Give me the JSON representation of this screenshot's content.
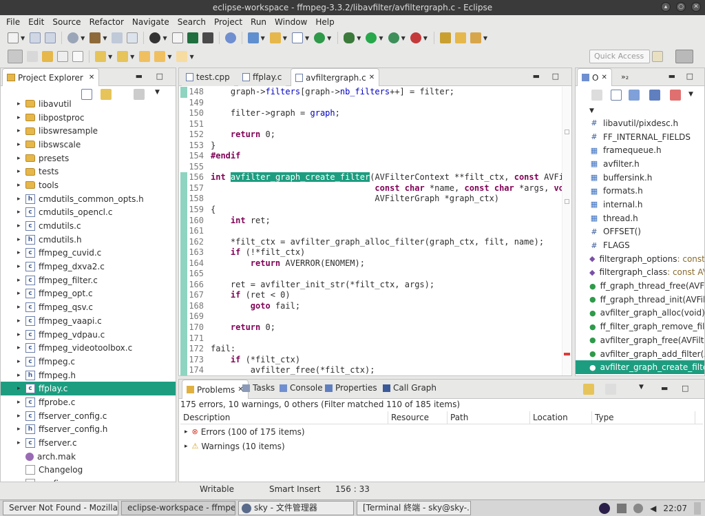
{
  "window": {
    "title": "eclipse-workspace - ffmpeg-3.3.2/libavfilter/avfiltergraph.c - Eclipse"
  },
  "menu": [
    "File",
    "Edit",
    "Source",
    "Refactor",
    "Navigate",
    "Search",
    "Project",
    "Run",
    "Window",
    "Help"
  ],
  "toolbar": {
    "quick_access_placeholder": "Quick Access"
  },
  "explorer": {
    "title": "Project Explorer",
    "items": [
      {
        "label": "libavutil",
        "kind": "folder",
        "arrow": "▸"
      },
      {
        "label": "libpostproc",
        "kind": "folder",
        "arrow": "▸"
      },
      {
        "label": "libswresample",
        "kind": "folder",
        "arrow": "▸"
      },
      {
        "label": "libswscale",
        "kind": "folder",
        "arrow": "▸"
      },
      {
        "label": "presets",
        "kind": "folder",
        "arrow": "▸"
      },
      {
        "label": "tests",
        "kind": "folder",
        "arrow": "▸"
      },
      {
        "label": "tools",
        "kind": "folder",
        "arrow": "▸"
      },
      {
        "label": "cmdutils_common_opts.h",
        "kind": "h",
        "arrow": "▸"
      },
      {
        "label": "cmdutils_opencl.c",
        "kind": "c",
        "arrow": "▸"
      },
      {
        "label": "cmdutils.c",
        "kind": "c",
        "arrow": "▸"
      },
      {
        "label": "cmdutils.h",
        "kind": "h",
        "arrow": "▸"
      },
      {
        "label": "ffmpeg_cuvid.c",
        "kind": "c",
        "arrow": "▸"
      },
      {
        "label": "ffmpeg_dxva2.c",
        "kind": "c",
        "arrow": "▸"
      },
      {
        "label": "ffmpeg_filter.c",
        "kind": "c",
        "arrow": "▸"
      },
      {
        "label": "ffmpeg_opt.c",
        "kind": "c",
        "arrow": "▸"
      },
      {
        "label": "ffmpeg_qsv.c",
        "kind": "c",
        "arrow": "▸"
      },
      {
        "label": "ffmpeg_vaapi.c",
        "kind": "c",
        "arrow": "▸"
      },
      {
        "label": "ffmpeg_vdpau.c",
        "kind": "c",
        "arrow": "▸"
      },
      {
        "label": "ffmpeg_videotoolbox.c",
        "kind": "c",
        "arrow": "▸"
      },
      {
        "label": "ffmpeg.c",
        "kind": "c",
        "arrow": "▸"
      },
      {
        "label": "ffmpeg.h",
        "kind": "h",
        "arrow": "▸"
      },
      {
        "label": "ffplay.c",
        "kind": "c",
        "arrow": "▸",
        "selected": true
      },
      {
        "label": "ffprobe.c",
        "kind": "c",
        "arrow": "▸"
      },
      {
        "label": "ffserver_config.c",
        "kind": "c",
        "arrow": "▸"
      },
      {
        "label": "ffserver_config.h",
        "kind": "h",
        "arrow": "▸"
      },
      {
        "label": "ffserver.c",
        "kind": "c",
        "arrow": "▸"
      },
      {
        "label": "arch.mak",
        "kind": "mak",
        "arrow": ""
      },
      {
        "label": "Changelog",
        "kind": "txt",
        "arrow": ""
      },
      {
        "label": "configure",
        "kind": "txt",
        "arrow": ""
      }
    ]
  },
  "editor": {
    "tabs": [
      {
        "label": "test.cpp",
        "active": false
      },
      {
        "label": "ffplay.c",
        "active": false
      },
      {
        "label": "avfiltergraph.c",
        "active": true
      }
    ],
    "lines": [
      {
        "n": "148",
        "t": "    graph->filters[graph->nb_filters++] = filter;",
        "mark": true
      },
      {
        "n": "149",
        "t": "",
        "mark": false
      },
      {
        "n": "150",
        "t": "    filter->graph = graph;",
        "mark": false
      },
      {
        "n": "151",
        "t": "",
        "mark": false
      },
      {
        "n": "152",
        "t": "    return 0;",
        "mark": false
      },
      {
        "n": "153",
        "t": "}",
        "mark": false
      },
      {
        "n": "154",
        "t": "#endif",
        "mark": false
      },
      {
        "n": "155",
        "t": "",
        "mark": false
      },
      {
        "n": "156",
        "t": "int avfilter_graph_create_filter(AVFilterContext **filt_ctx, const AVFilte",
        "mark": true
      },
      {
        "n": "157",
        "t": "                                 const char *name, const char *args, void",
        "mark": true
      },
      {
        "n": "158",
        "t": "                                 AVFilterGraph *graph_ctx)",
        "mark": true
      },
      {
        "n": "159",
        "t": "{",
        "mark": true
      },
      {
        "n": "160",
        "t": "    int ret;",
        "mark": true
      },
      {
        "n": "161",
        "t": "",
        "mark": true
      },
      {
        "n": "162",
        "t": "    *filt_ctx = avfilter_graph_alloc_filter(graph_ctx, filt, name);",
        "mark": true
      },
      {
        "n": "163",
        "t": "    if (!*filt_ctx)",
        "mark": true
      },
      {
        "n": "164",
        "t": "        return AVERROR(ENOMEM);",
        "mark": true
      },
      {
        "n": "165",
        "t": "",
        "mark": true
      },
      {
        "n": "166",
        "t": "    ret = avfilter_init_str(*filt_ctx, args);",
        "mark": true
      },
      {
        "n": "167",
        "t": "    if (ret < 0)",
        "mark": true
      },
      {
        "n": "168",
        "t": "        goto fail;",
        "mark": true
      },
      {
        "n": "169",
        "t": "",
        "mark": true
      },
      {
        "n": "170",
        "t": "    return 0;",
        "mark": true
      },
      {
        "n": "171",
        "t": "",
        "mark": true
      },
      {
        "n": "172",
        "t": "fail:",
        "mark": true
      },
      {
        "n": "173",
        "t": "    if (*filt_ctx)",
        "mark": true
      },
      {
        "n": "174",
        "t": "        avfilter_free(*filt_ctx);",
        "mark": true
      }
    ]
  },
  "outline": {
    "tab_label": "O",
    "overflow_label": "»₂",
    "items": [
      {
        "label": "libavutil/pixdesc.h",
        "icon": "#",
        "type": ""
      },
      {
        "label": "FF_INTERNAL_FIELDS",
        "icon": "#",
        "type": ""
      },
      {
        "label": "framequeue.h",
        "icon": "▦",
        "type": ""
      },
      {
        "label": "avfilter.h",
        "icon": "▦",
        "type": ""
      },
      {
        "label": "buffersink.h",
        "icon": "▦",
        "type": ""
      },
      {
        "label": "formats.h",
        "icon": "▦",
        "type": ""
      },
      {
        "label": "internal.h",
        "icon": "▦",
        "type": ""
      },
      {
        "label": "thread.h",
        "icon": "▦",
        "type": ""
      },
      {
        "label": "OFFSET()",
        "icon": "#",
        "type": ""
      },
      {
        "label": "FLAGS",
        "icon": "#",
        "type": ""
      },
      {
        "label": "filtergraph_options",
        "icon": "◆",
        "type": " : const AV"
      },
      {
        "label": "filtergraph_class",
        "icon": "◆",
        "type": " : const AVCL"
      },
      {
        "label": "ff_graph_thread_free(AVFilte",
        "icon": "●",
        "type": ""
      },
      {
        "label": "ff_graph_thread_init(AVFilter",
        "icon": "●",
        "type": ""
      },
      {
        "label": "avfilter_graph_alloc(void)",
        "icon": "●",
        "type": " : AV"
      },
      {
        "label": "ff_filter_graph_remove_filte",
        "icon": "●",
        "type": ""
      },
      {
        "label": "avfilter_graph_free(AVFilterG",
        "icon": "●",
        "type": ""
      },
      {
        "label": "avfilter_graph_add_filter(AVF",
        "icon": "●",
        "type": ""
      },
      {
        "label": "avfilter_graph_create_filter(A",
        "icon": "●",
        "type": "",
        "selected": true
      }
    ]
  },
  "problems": {
    "tabs": [
      "Problems",
      "Tasks",
      "Console",
      "Properties",
      "Call Graph"
    ],
    "summary": "175 errors, 10 warnings, 0 others (Filter matched 110 of 185 items)",
    "columns": [
      "Description",
      "Resource",
      "Path",
      "Location",
      "Type"
    ],
    "rows": [
      {
        "label": "Errors (100 of 175 items)",
        "icon": "error-icon"
      },
      {
        "label": "Warnings (10 items)",
        "icon": "warning-icon"
      }
    ]
  },
  "status": {
    "writable": "Writable",
    "insert_mode": "Smart Insert",
    "position": "156 : 33"
  },
  "taskbar": {
    "tasks": [
      "Server Not Found - Mozilla...",
      "eclipse-workspace - ffmpe...",
      "sky - 文件管理器",
      "[Terminal 終端 - sky@sky-..."
    ],
    "clock": "22:07"
  },
  "colors": {
    "selection": "#1d9d80",
    "keyword": "#7f0055",
    "field": "#0000c0"
  }
}
